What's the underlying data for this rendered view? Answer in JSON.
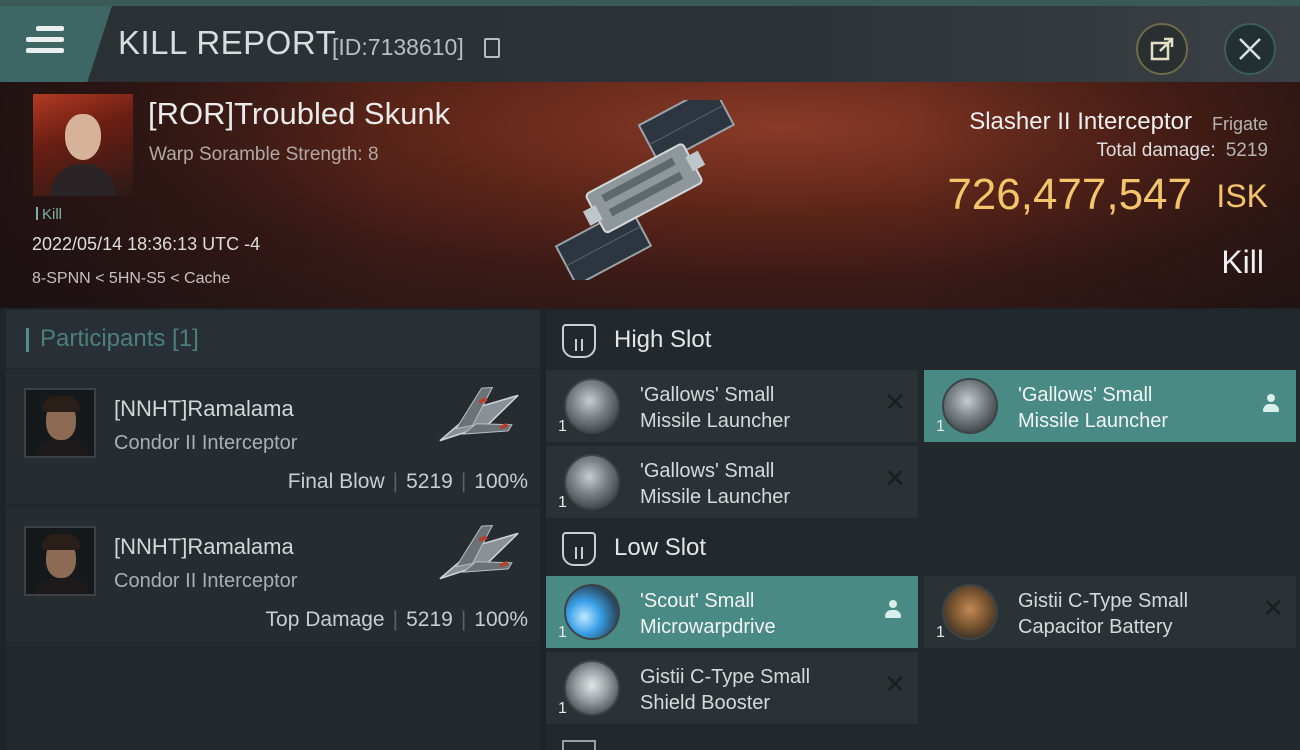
{
  "header": {
    "title": "KILL REPORT",
    "id": "[ID:7138610]"
  },
  "victim": {
    "name": "[ROR]Troubled Skunk",
    "scramble": "Warp Soramble Strength: 8",
    "tag": "Kill",
    "timestamp": "2022/05/14 18:36:13 UTC -4",
    "location": "8-SPNN < 5HN-S5 < Cache"
  },
  "ship": {
    "name": "Slasher II Interceptor",
    "class": "Frigate",
    "total_damage_label": "Total damage:",
    "total_damage": "5219",
    "isk_value": "726,477,547",
    "isk_unit": "ISK",
    "result": "Kill"
  },
  "participants": {
    "title": "Participants [1]",
    "rows": [
      {
        "name": "[NNHT]Ramalama",
        "ship": "Condor II Interceptor",
        "role": "Final Blow",
        "damage": "5219",
        "percent": "100%"
      },
      {
        "name": "[NNHT]Ramalama",
        "ship": "Condor II Interceptor",
        "role": "Top Damage",
        "damage": "5219",
        "percent": "100%"
      }
    ]
  },
  "slots": {
    "high": {
      "title": "High Slot",
      "modules": [
        {
          "name": "'Gallows' Small\nMissile Launcher",
          "qty": "1",
          "status": "destroyed"
        },
        {
          "name": "'Gallows' Small\nMissile Launcher",
          "qty": "1",
          "status": "dropped"
        },
        {
          "name": "'Gallows' Small\nMissile Launcher",
          "qty": "1",
          "status": "destroyed"
        }
      ]
    },
    "low": {
      "title": "Low Slot",
      "modules": [
        {
          "name": "'Scout' Small\nMicrowarpdrive",
          "qty": "1",
          "status": "dropped"
        },
        {
          "name": "Gistii C-Type Small\nCapacitor Battery",
          "qty": "1",
          "status": "destroyed"
        },
        {
          "name": "Gistii C-Type Small\nShield Booster",
          "qty": "1",
          "status": "destroyed"
        }
      ]
    }
  },
  "colors": {
    "accent_teal": "#4a8a84",
    "isk_gold": "#f2c46b"
  }
}
